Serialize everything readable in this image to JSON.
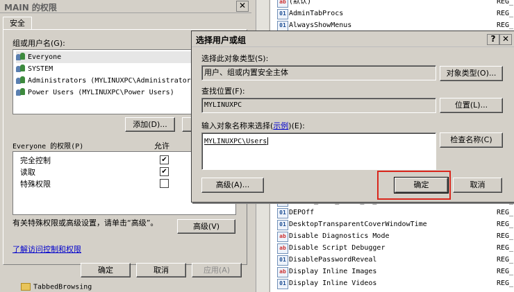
{
  "perm_window": {
    "title": "MAIN 的权限",
    "close": "✕",
    "tab": "安全",
    "group_label": "组或用户名(G):",
    "users": [
      "Everyone",
      "SYSTEM",
      "Administrators (MYLINUXPC\\Administrators)",
      "Power Users (MYLINUXPC\\Power Users)"
    ],
    "add_button": "添加(D)...",
    "perm_header": "Everyone 的权限(P)",
    "allow_header": "允许",
    "permissions": [
      {
        "name": "完全控制",
        "allow": true
      },
      {
        "name": "读取",
        "allow": true
      },
      {
        "name": "特殊权限",
        "allow": false
      }
    ],
    "special_text": "有关特殊权限或高级设置，请单击“高级”。",
    "advanced_button": "高级(V)",
    "learn_link": "了解访问控制和权限",
    "ok": "确定",
    "cancel": "取消",
    "apply": "应用(A)",
    "tree_item": "TabbedBrowsing"
  },
  "registry": {
    "top_rows": [
      {
        "icon": "ab",
        "name": "(默认)",
        "type": "REG_"
      },
      {
        "icon": "bin",
        "name": "AdminTabProcs",
        "type": "REG_"
      },
      {
        "icon": "bin",
        "name": "AlwaysShowMenus",
        "type": "REG_"
      }
    ],
    "bottom_rows": [
      {
        "icon": "ab",
        "name": "Delete_Temp_Files_On_Exit",
        "type": "REG_"
      },
      {
        "icon": "bin",
        "name": "DEPOff",
        "type": "REG_"
      },
      {
        "icon": "bin",
        "name": "DesktopTransparentCoverWindowTime",
        "type": "REG_"
      },
      {
        "icon": "ab",
        "name": "Disable Diagnostics Mode",
        "type": "REG_"
      },
      {
        "icon": "ab",
        "name": "Disable Script Debugger",
        "type": "REG_"
      },
      {
        "icon": "bin",
        "name": "DisablePasswordReveal",
        "type": "REG_"
      },
      {
        "icon": "ab",
        "name": "Display Inline Images",
        "type": "REG_"
      },
      {
        "icon": "bin",
        "name": "Display Inline Videos",
        "type": "REG_"
      }
    ]
  },
  "dialog": {
    "title": "选择用户或组",
    "help": "?",
    "close": "✕",
    "object_type_label": "选择此对象类型(S):",
    "object_type_value": "用户、组或内置安全主体",
    "object_type_button": "对象类型(O)...",
    "location_label": "查找位置(F):",
    "location_value": "MYLINUXPC",
    "location_button": "位置(L)...",
    "enter_label_pre": "输入对象名称来选择(",
    "enter_label_link": "示例",
    "enter_label_post": ")(E):",
    "enter_value": "MYLINUXPC\\Users",
    "check_names_button": "检查名称(C)",
    "advanced_button": "高级(A)...",
    "ok_button": "确定",
    "cancel_button": "取消"
  }
}
